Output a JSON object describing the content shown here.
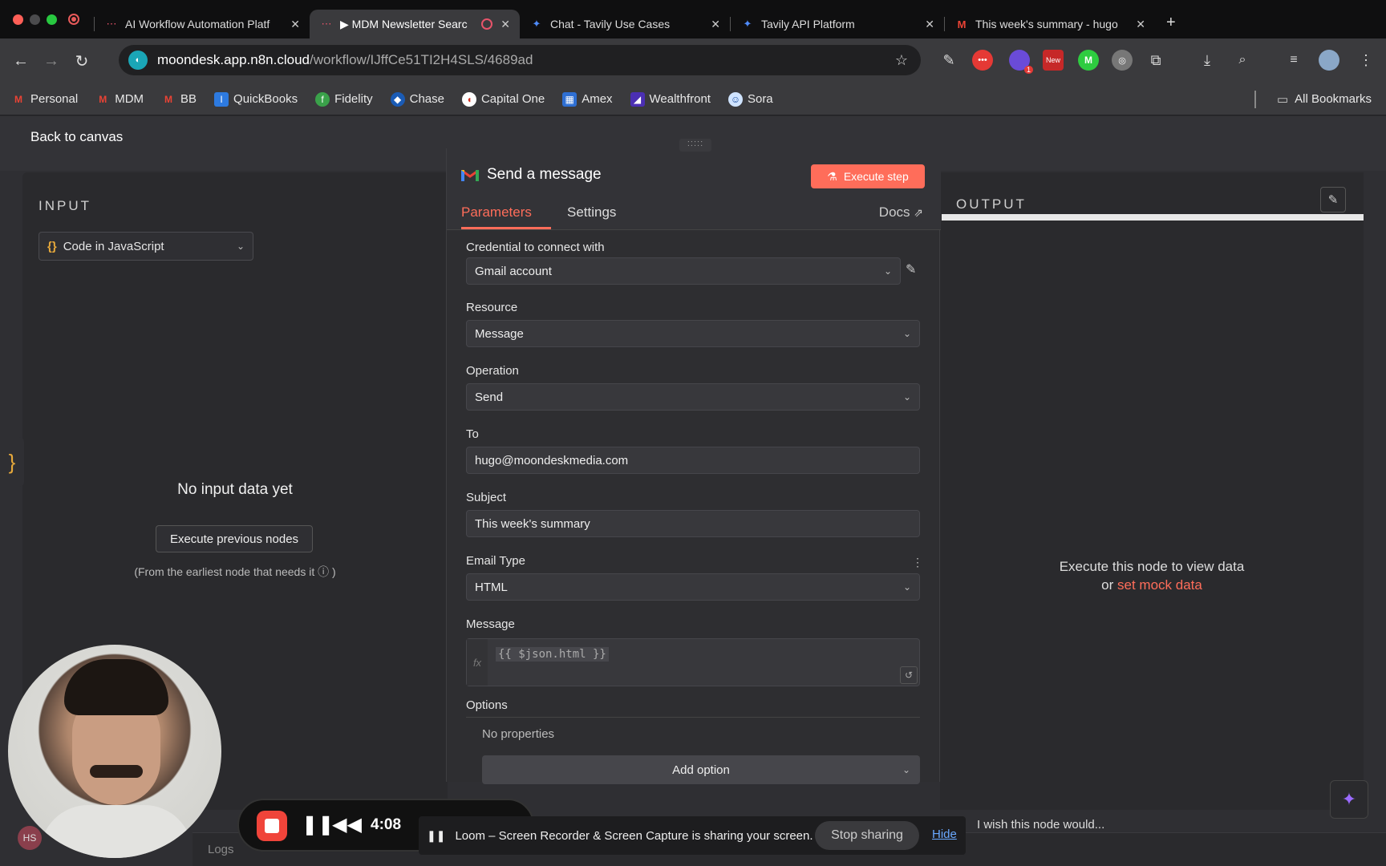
{
  "browser": {
    "tabs": [
      {
        "label": "AI Workflow Automation Platf",
        "icon": "n8n-icon",
        "active": false
      },
      {
        "label": "▶ MDM Newsletter Searc",
        "icon": "n8n-icon",
        "active": true
      },
      {
        "label": "Chat - Tavily Use Cases",
        "icon": "tavily-icon",
        "active": false
      },
      {
        "label": "Tavily API Platform",
        "icon": "tavily-icon",
        "active": false
      },
      {
        "label": "This week's summary - hugo",
        "icon": "gmail-icon",
        "active": false
      }
    ],
    "url_host": "moondesk.app.n8n.cloud",
    "url_path": "/workflow/IJffCe51TI2H4SLS/4689ad",
    "bookmarks": [
      {
        "label": "Personal",
        "icon": "gmail-icon"
      },
      {
        "label": "MDM",
        "icon": "gmail-icon"
      },
      {
        "label": "BB",
        "icon": "gmail-icon"
      },
      {
        "label": "QuickBooks",
        "icon": "quickbooks-icon"
      },
      {
        "label": "Fidelity",
        "icon": "fidelity-icon"
      },
      {
        "label": "Chase",
        "icon": "chase-icon"
      },
      {
        "label": "Capital One",
        "icon": "capitalone-icon"
      },
      {
        "label": "Amex",
        "icon": "amex-icon"
      },
      {
        "label": "Wealthfront",
        "icon": "wealthfront-icon"
      },
      {
        "label": "Sora",
        "icon": "sora-icon"
      }
    ],
    "all_bookmarks": "All Bookmarks",
    "ext_new_badge": "New",
    "ext_count_badge": "1"
  },
  "canvas": {
    "back_label": "Back to canvas"
  },
  "input_pane": {
    "title": "INPUT",
    "source_select": "Code in JavaScript",
    "empty_title": "No input data yet",
    "execute_prev": "Execute previous nodes",
    "hint": "(From the earliest node that needs it ⓘ )"
  },
  "node": {
    "title": "Send a message",
    "execute_step": "Execute step",
    "tabs": [
      "Parameters",
      "Settings"
    ],
    "docs": "Docs",
    "fields": {
      "credential_label": "Credential to connect with",
      "credential_value": "Gmail account",
      "resource_label": "Resource",
      "resource_value": "Message",
      "operation_label": "Operation",
      "operation_value": "Send",
      "to_label": "To",
      "to_value": "hugo@moondeskmedia.com",
      "subject_label": "Subject",
      "subject_value": "This week's summary",
      "email_type_label": "Email Type",
      "email_type_value": "HTML",
      "message_label": "Message",
      "message_value": "{{ $json.html }}",
      "options_label": "Options",
      "no_properties": "No properties",
      "add_option": "Add option"
    }
  },
  "output_pane": {
    "title": "OUTPUT",
    "msg_line1": "Execute this node to view data",
    "msg_or": "or",
    "msg_link": "set mock data"
  },
  "footer": {
    "logs": "Logs",
    "wish": "I wish this node would..."
  },
  "loom": {
    "time": "4:08",
    "share_text": "Loom – Screen Recorder & Screen Capture is sharing your screen.",
    "stop_sharing": "Stop sharing",
    "hide": "Hide"
  },
  "avatar_initials": "HS",
  "colors": {
    "accent": "#ff6d5a",
    "link": "#6aa9ff",
    "js_brace": "#e7a93b"
  }
}
